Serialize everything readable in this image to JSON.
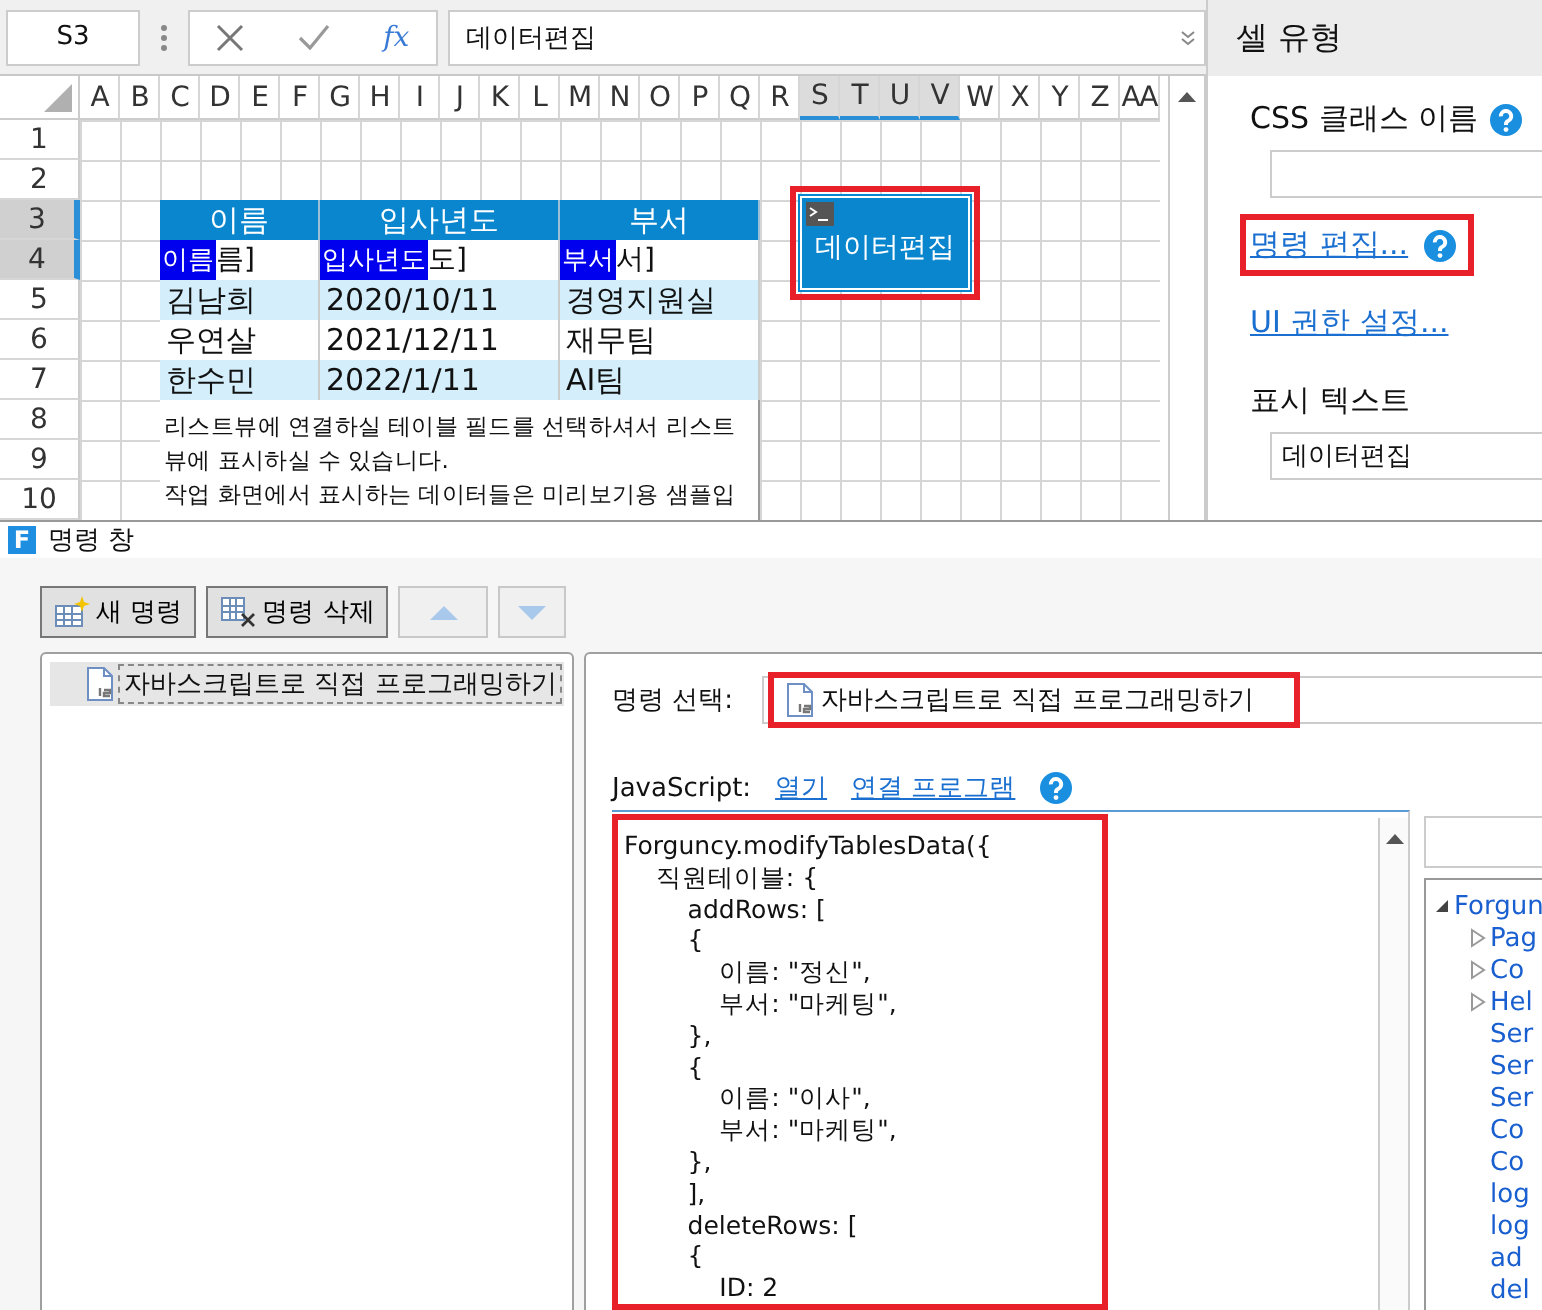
{
  "formula_bar": {
    "cell_ref": "S3",
    "function_label": "fx",
    "formula": "데이터편집"
  },
  "sheet": {
    "columns": [
      {
        "label": "A",
        "selected": false
      },
      {
        "label": "B",
        "selected": false
      },
      {
        "label": "C",
        "selected": false
      },
      {
        "label": "D",
        "selected": false
      },
      {
        "label": "E",
        "selected": false
      },
      {
        "label": "F",
        "selected": false
      },
      {
        "label": "G",
        "selected": false
      },
      {
        "label": "H",
        "selected": false
      },
      {
        "label": "I",
        "selected": false
      },
      {
        "label": "J",
        "selected": false
      },
      {
        "label": "K",
        "selected": false
      },
      {
        "label": "L",
        "selected": false
      },
      {
        "label": "M",
        "selected": false
      },
      {
        "label": "N",
        "selected": false
      },
      {
        "label": "O",
        "selected": false
      },
      {
        "label": "P",
        "selected": false
      },
      {
        "label": "Q",
        "selected": false
      },
      {
        "label": "R",
        "selected": false
      },
      {
        "label": "S",
        "selected": true
      },
      {
        "label": "T",
        "selected": true
      },
      {
        "label": "U",
        "selected": true
      },
      {
        "label": "V",
        "selected": true
      },
      {
        "label": "W",
        "selected": false
      },
      {
        "label": "X",
        "selected": false
      },
      {
        "label": "Y",
        "selected": false
      },
      {
        "label": "Z",
        "selected": false
      },
      {
        "label": "AA",
        "selected": false
      }
    ],
    "rows": [
      {
        "label": "1",
        "selected": false
      },
      {
        "label": "2",
        "selected": false
      },
      {
        "label": "3",
        "selected": true
      },
      {
        "label": "4",
        "selected": true
      },
      {
        "label": "5",
        "selected": false
      },
      {
        "label": "6",
        "selected": false
      },
      {
        "label": "7",
        "selected": false
      },
      {
        "label": "8",
        "selected": false
      },
      {
        "label": "9",
        "selected": false
      },
      {
        "label": "10",
        "selected": false
      }
    ],
    "table": {
      "headers": [
        "이름",
        "입사년도",
        "부서"
      ],
      "template": [
        {
          "tag": "이름",
          "text": "름]"
        },
        {
          "tag": "입사년도",
          "text": "도]"
        },
        {
          "tag": "부서",
          "text": "서]"
        }
      ],
      "rows": [
        [
          "김남희",
          "2020/10/11",
          "경영지원실"
        ],
        [
          "우연살",
          "2021/12/11",
          "재무팀"
        ],
        [
          "한수민",
          "2022/1/11",
          "AI팀"
        ]
      ]
    },
    "notes": [
      "리스트뷰에 연결하실 테이블 필드를 선택하셔서 리스트뷰에 표시하실 수 있습니다.",
      "작업 화면에서 표시하는 데이터들은 미리보기용 샘플입"
    ],
    "button": {
      "label": "데이터편집",
      "selected": true,
      "highlighted": true
    }
  },
  "cell_type_panel": {
    "title": "셀 유형",
    "css_class_label": "CSS 클래스 이름",
    "links": [
      {
        "label": "명령 편집...",
        "help": true,
        "highlighted": true
      },
      {
        "label": "UI 권한 설정...",
        "help": false,
        "highlighted": false
      }
    ],
    "display_text_label": "표시 텍스트",
    "display_text_value": "데이터편집"
  },
  "command_window": {
    "logo": "F",
    "title": "명령 창",
    "toolbar": [
      {
        "kind": "new",
        "label": "새 명령",
        "disabled": false
      },
      {
        "kind": "delete",
        "label": "명령 삭제",
        "disabled": false
      },
      {
        "kind": "up",
        "disabled": true
      },
      {
        "kind": "down",
        "disabled": true
      }
    ],
    "commands": [
      {
        "label": "자바스크립트로 직접 프로그래밍하기",
        "selected": true
      }
    ],
    "command_select": {
      "label": "명령 선택:",
      "value": "자바스크립트로 직접 프로그래밍하기",
      "highlighted": true
    },
    "javascript": {
      "label": "JavaScript:",
      "links": [
        "열기",
        "연결 프로그램"
      ]
    },
    "code": {
      "highlighted": true,
      "lines": [
        "Forguncy.modifyTablesData({",
        "    직원테이블: {",
        "        addRows: [",
        "        {",
        "            이름: \"정신\",",
        "            부서: \"마케팅\",",
        "        },",
        "        {",
        "            이름: \"이사\",",
        "            부서: \"마케팅\",",
        "        },",
        "        ],",
        "        deleteRows: [",
        "        {",
        "            ID: 2"
      ]
    },
    "api_tree": [
      {
        "label": "Forgun",
        "kind": "group",
        "expanded": true,
        "children": [
          {
            "label": "Pag",
            "kind": "group",
            "expanded": false
          },
          {
            "label": "Co",
            "kind": "group",
            "expanded": false
          },
          {
            "label": "Hel",
            "kind": "group",
            "expanded": false
          },
          {
            "label": "Ser",
            "kind": "item"
          },
          {
            "label": "Ser",
            "kind": "item"
          },
          {
            "label": "Ser",
            "kind": "item"
          },
          {
            "label": "Co",
            "kind": "item"
          },
          {
            "label": "Co",
            "kind": "item"
          },
          {
            "label": "log",
            "kind": "item"
          },
          {
            "label": "log",
            "kind": "item"
          },
          {
            "label": "ad",
            "kind": "item"
          },
          {
            "label": "del",
            "kind": "item"
          }
        ]
      }
    ]
  }
}
